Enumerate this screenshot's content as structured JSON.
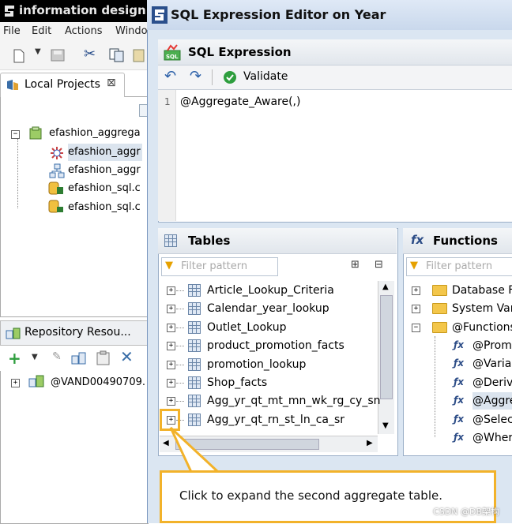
{
  "background_window": {
    "title": "information design t",
    "menu": [
      "File",
      "Edit",
      "Actions",
      "Windo"
    ],
    "local_projects": {
      "tab_label": "Local Projects",
      "tree": [
        {
          "label": "efashion_aggrega",
          "level": 0,
          "expanded": true
        },
        {
          "label": "efashion_aggr",
          "level": 1,
          "selected": true
        },
        {
          "label": "efashion_aggr",
          "level": 1
        },
        {
          "label": "efashion_sql.c",
          "level": 1
        },
        {
          "label": "efashion_sql.c",
          "level": 1
        }
      ]
    },
    "repository": {
      "tab_label": "Repository Resou...",
      "tree": [
        {
          "label": "@VAND00490709."
        }
      ]
    }
  },
  "dialog": {
    "title": "SQL Expression Editor on Year",
    "sql_section": {
      "title": "SQL Expression",
      "validate_label": "Validate",
      "line_number": "1",
      "expression": "@Aggregate_Aware(,)"
    },
    "tables_section": {
      "title": "Tables",
      "filter_placeholder": "Filter pattern",
      "items": [
        "Article_Lookup_Criteria",
        "Calendar_year_lookup",
        "Outlet_Lookup",
        "product_promotion_facts",
        "promotion_lookup",
        "Shop_facts",
        "Agg_yr_qt_mt_mn_wk_rg_cy_sn",
        "Agg_yr_qt_rn_st_ln_ca_sr"
      ]
    },
    "functions_section": {
      "title": "Functions",
      "filter_placeholder": "Filter pattern",
      "folders": [
        "Database F",
        "System Vari",
        "@Functions"
      ],
      "functions": [
        "@Promp",
        "@Variab",
        "@Deriv",
        "@Aggre",
        "@Selec",
        "@Wher"
      ]
    }
  },
  "callout": {
    "text": "Click to expand the second aggregate table."
  },
  "watermark": "CSDN @DB架构",
  "colors": {
    "callout_border": "#f2b22a",
    "dialog_bg": "#dbe6f2",
    "validate_green": "#2e9e3e"
  }
}
